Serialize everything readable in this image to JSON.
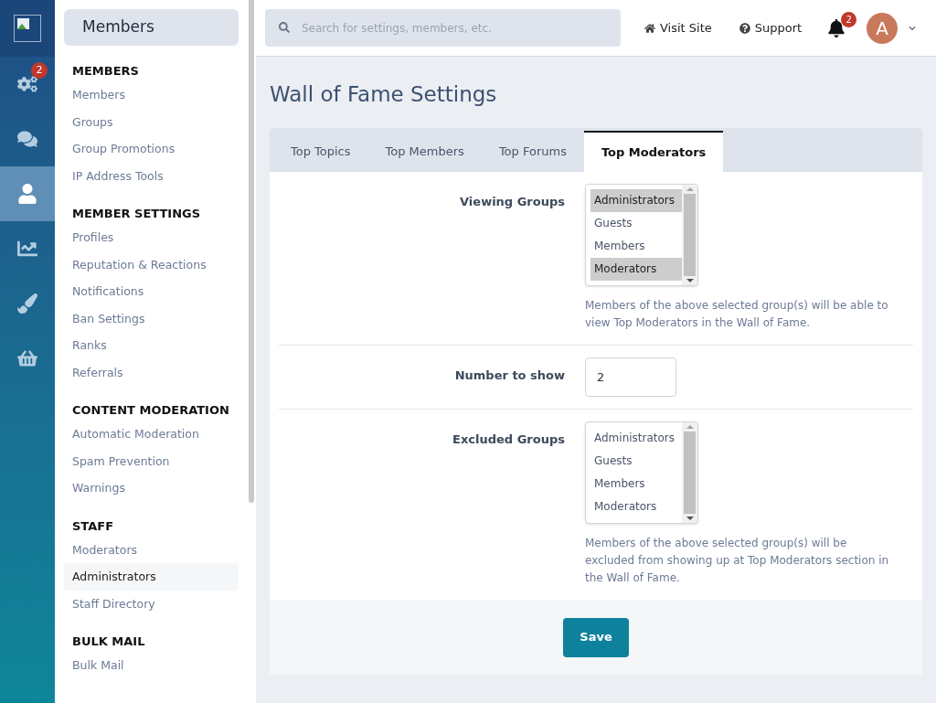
{
  "rail": {
    "items": [
      {
        "kind": "cogs",
        "badge": "2",
        "selected": false
      },
      {
        "kind": "comments",
        "selected": false
      },
      {
        "kind": "user",
        "selected": true
      },
      {
        "kind": "chart",
        "selected": false
      },
      {
        "kind": "brush",
        "selected": false
      },
      {
        "kind": "basket",
        "selected": false
      }
    ]
  },
  "sidebar": {
    "title": "Members",
    "sections": [
      {
        "title": "MEMBERS",
        "items": [
          {
            "label": "Members",
            "selected": false
          },
          {
            "label": "Groups",
            "selected": false
          },
          {
            "label": "Group Promotions",
            "selected": false
          },
          {
            "label": "IP Address Tools",
            "selected": false
          }
        ]
      },
      {
        "title": "MEMBER SETTINGS",
        "items": [
          {
            "label": "Profiles",
            "selected": false
          },
          {
            "label": "Reputation & Reactions",
            "selected": false
          },
          {
            "label": "Notifications",
            "selected": false
          },
          {
            "label": "Ban Settings",
            "selected": false
          },
          {
            "label": "Ranks",
            "selected": false
          },
          {
            "label": "Referrals",
            "selected": false
          }
        ]
      },
      {
        "title": "CONTENT MODERATION",
        "items": [
          {
            "label": "Automatic Moderation",
            "selected": false
          },
          {
            "label": "Spam Prevention",
            "selected": false
          },
          {
            "label": "Warnings",
            "selected": false
          }
        ]
      },
      {
        "title": "STAFF",
        "items": [
          {
            "label": "Moderators",
            "selected": false
          },
          {
            "label": "Administrators",
            "selected": true
          },
          {
            "label": "Staff Directory",
            "selected": false
          }
        ]
      },
      {
        "title": "BULK MAIL",
        "items": [
          {
            "label": "Bulk Mail",
            "selected": false
          }
        ]
      }
    ]
  },
  "topbar": {
    "search": {
      "placeholder": "Search for settings, members, etc."
    },
    "links": [
      {
        "kind": "home",
        "label": "Visit Site"
      },
      {
        "kind": "help",
        "label": "Support"
      }
    ],
    "notifications_badge": "2",
    "avatar_letter": "A"
  },
  "page": {
    "title": "Wall of Fame Settings",
    "tabs": [
      {
        "label": "Top Topics",
        "selected": false
      },
      {
        "label": "Top Members",
        "selected": false
      },
      {
        "label": "Top Forums",
        "selected": false
      },
      {
        "label": "Top Moderators",
        "selected": true
      }
    ],
    "fields": [
      {
        "kind": "listbox",
        "label": "Viewing Groups",
        "options": [
          {
            "label": "Administrators",
            "selected": true
          },
          {
            "label": "Guests",
            "selected": false
          },
          {
            "label": "Members",
            "selected": false
          },
          {
            "label": "Moderators",
            "selected": true
          }
        ],
        "help": "Members of the above selected group(s) will be able to view Top Moderators in the Wall of Fame."
      },
      {
        "kind": "number",
        "label": "Number to show",
        "value": "2"
      },
      {
        "kind": "listbox",
        "label": "Excluded Groups",
        "options": [
          {
            "label": "Administrators",
            "selected": false
          },
          {
            "label": "Guests",
            "selected": false
          },
          {
            "label": "Members",
            "selected": false
          },
          {
            "label": "Moderators",
            "selected": false
          }
        ],
        "help": "Members of the above selected group(s) will be excluded from showing up at Top Moderators section in the Wall of Fame."
      }
    ],
    "save_button": "Save"
  }
}
